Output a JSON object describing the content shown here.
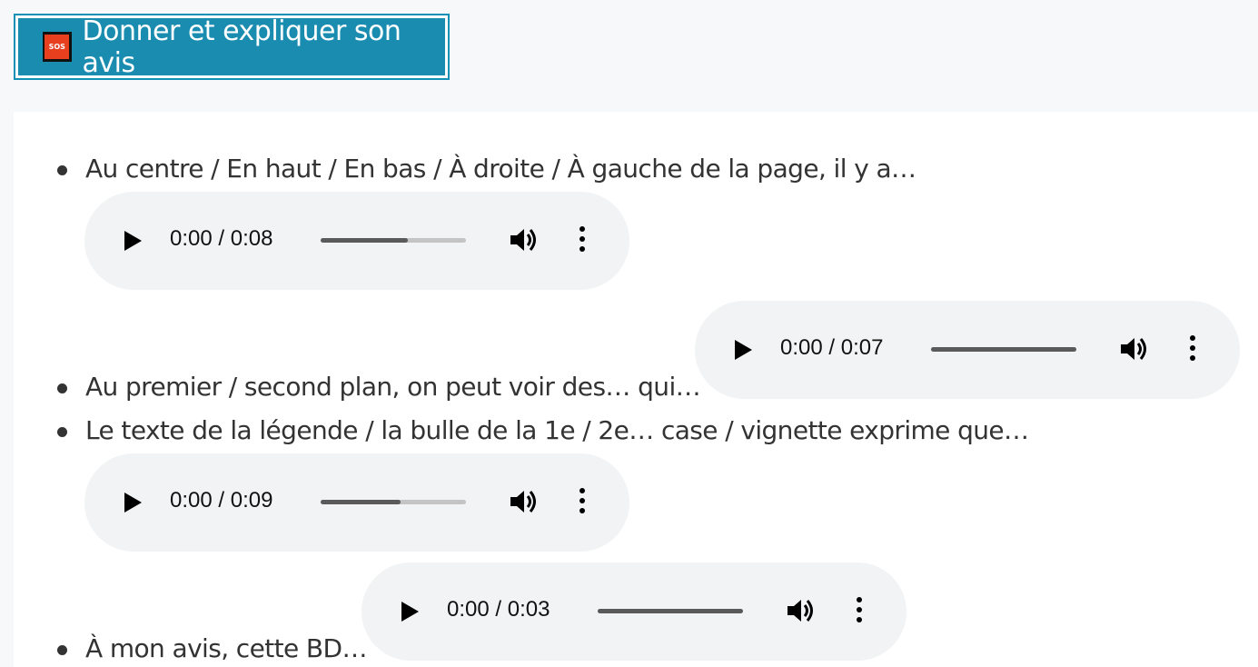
{
  "header": {
    "icon_text": "SOS",
    "title": "Donner et expliquer son avis"
  },
  "items": [
    {
      "text": "Au centre / En haut / En bas / À droite / À gauche de la page, il y a…"
    },
    {
      "text": "Au premier / second plan, on peut voir des… qui…"
    },
    {
      "text": "Le texte de la légende / la bulle de la 1e / 2e… case / vignette exprime que…"
    },
    {
      "text": "À mon avis, cette BD…"
    }
  ],
  "audio_players": [
    {
      "time": "0:00 / 0:08",
      "buffered": 0.6
    },
    {
      "time": "0:00 / 0:07",
      "buffered": 1.0
    },
    {
      "time": "0:00 / 0:09",
      "buffered": 0.55
    },
    {
      "time": "0:00 / 0:03",
      "buffered": 1.0
    }
  ],
  "colors": {
    "header_bg": "#1a8cb0",
    "header_border": "#1290b6",
    "sos_red": "#e8401f",
    "player_bg": "#f1f3f4"
  },
  "icons": {
    "play": "play-icon",
    "volume": "volume-icon",
    "more": "more-vert-icon"
  }
}
